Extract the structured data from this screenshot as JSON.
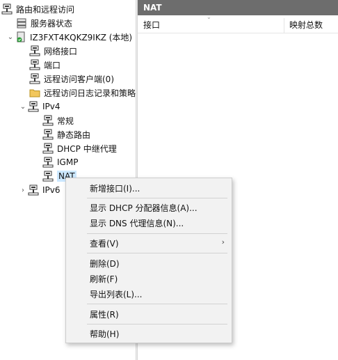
{
  "tree": {
    "items": [
      {
        "label": "路由和远程访问",
        "icon": "routing-icon"
      },
      {
        "label": "服务器状态",
        "icon": "server-status-icon"
      },
      {
        "label": "IZ3FXT4KQKZ9IKZ (本地)",
        "icon": "server-icon"
      },
      {
        "label": "网络接口",
        "icon": "network-icon"
      },
      {
        "label": "端口",
        "icon": "network-icon"
      },
      {
        "label": "远程访问客户端(0)",
        "icon": "network-icon"
      },
      {
        "label": "远程访问日志记录和策略",
        "icon": "folder-icon"
      },
      {
        "label": "IPv4",
        "icon": "network-icon"
      },
      {
        "label": "常规",
        "icon": "network-icon"
      },
      {
        "label": "静态路由",
        "icon": "network-icon"
      },
      {
        "label": "DHCP 中继代理",
        "icon": "network-icon"
      },
      {
        "label": "IGMP",
        "icon": "network-icon"
      },
      {
        "label": "NAT",
        "icon": "network-icon"
      },
      {
        "label": "IPv6",
        "icon": "network-icon"
      }
    ]
  },
  "detail": {
    "title": "NAT",
    "columns": [
      "接口",
      "映射总数"
    ]
  },
  "context_menu": {
    "items": [
      {
        "label": "新增接口(I)..."
      },
      {
        "label": "显示 DHCP 分配器信息(A)..."
      },
      {
        "label": "显示 DNS 代理信息(N)..."
      },
      {
        "label": "查看(V)",
        "submenu_arrow": "›"
      },
      {
        "label": "删除(D)"
      },
      {
        "label": "刷新(F)"
      },
      {
        "label": "导出列表(L)..."
      },
      {
        "label": "属性(R)"
      },
      {
        "label": "帮助(H)"
      }
    ]
  },
  "colors": {
    "header_bg": "#6d6d6d",
    "selection": "#cce8ff",
    "menu_bg": "#f2f2f2"
  }
}
